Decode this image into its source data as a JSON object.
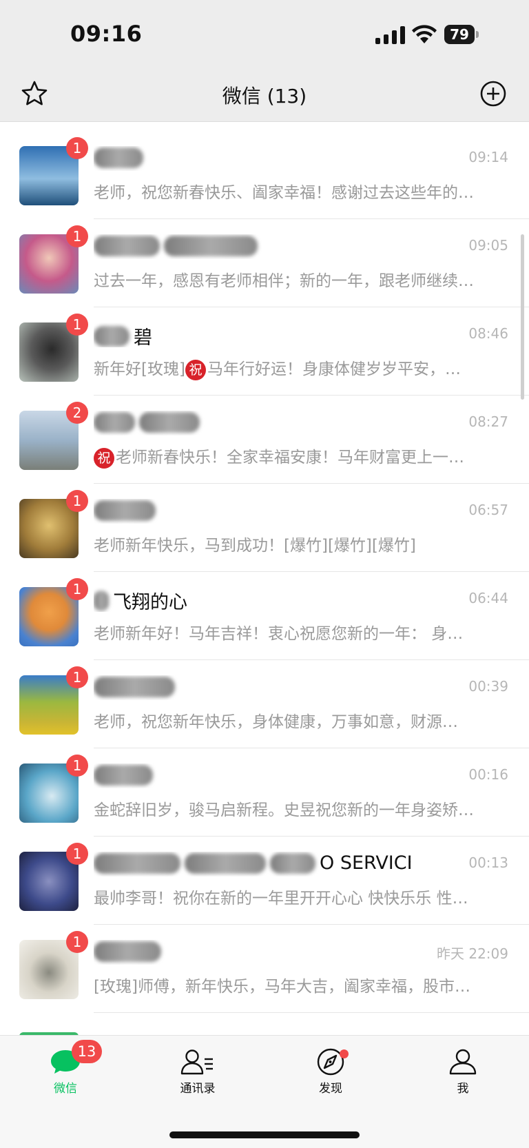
{
  "status_bar": {
    "time": "09:16",
    "battery": "79"
  },
  "header": {
    "title": "微信 (13)"
  },
  "chats": [
    {
      "name": "",
      "time": "09:14",
      "badge": "1",
      "message": "老师，祝您新春快乐、阖家幸福！感谢过去这些年的…",
      "avatar_color": "#2f6fb3"
    },
    {
      "name": "",
      "time": "09:05",
      "badge": "1",
      "message": "过去一年，感恩有老师相伴；新的一年，跟老师继续…",
      "avatar_color": "#c55a8a"
    },
    {
      "name": "碧",
      "time": "08:46",
      "badge": "1",
      "message": "新年好[玫瑰]",
      "message_after": "马年行好运！身康体健岁岁平安，…",
      "avatar_color": "#5a5a5a"
    },
    {
      "name": "",
      "time": "08:27",
      "badge": "2",
      "message": "",
      "message_after": "老师新春快乐！全家幸福安康！马年财富更上一…",
      "avatar_color": "#9ab2c8"
    },
    {
      "name": "",
      "time": "06:57",
      "badge": "1",
      "message": "老师新年快乐，马到成功！[爆竹][爆竹][爆竹]",
      "avatar_color": "#a07c3a"
    },
    {
      "name": "飞翔的心",
      "time": "06:44",
      "badge": "1",
      "message": "老师新年好！马年吉祥！衷心祝愿您新的一年： 身…",
      "avatar_color": "#e08a3a"
    },
    {
      "name": "",
      "time": "00:39",
      "badge": "1",
      "message": "老师，祝您新年快乐，身体健康，万事如意，财源…",
      "avatar_color": "#c9b535"
    },
    {
      "name": "",
      "time": "00:16",
      "badge": "1",
      "message": "金蛇辞旧岁，骏马启新程。史昱祝您新的一年身姿矫…",
      "avatar_color": "#5aa6c8"
    },
    {
      "name": "O SERVICE",
      "time": "00:13",
      "badge": "1",
      "message": "最帅李哥！祝你在新的一年里开开心心 快快乐乐 性…",
      "avatar_color": "#3d4a8a"
    },
    {
      "name": "",
      "time": "昨天 22:09",
      "badge": "1",
      "message": "[玫瑰]师傅，新年快乐，马年大吉，阖家幸福，股市…",
      "avatar_color": "#d8d4c8"
    }
  ],
  "zhu_glyph": "祝",
  "tabs": [
    {
      "label": "微信",
      "badge": "13",
      "active": true
    },
    {
      "label": "通讯录"
    },
    {
      "label": "发现"
    },
    {
      "label": "我"
    }
  ],
  "colors": {
    "accent": "#07c160",
    "badge": "#f14a4a"
  }
}
